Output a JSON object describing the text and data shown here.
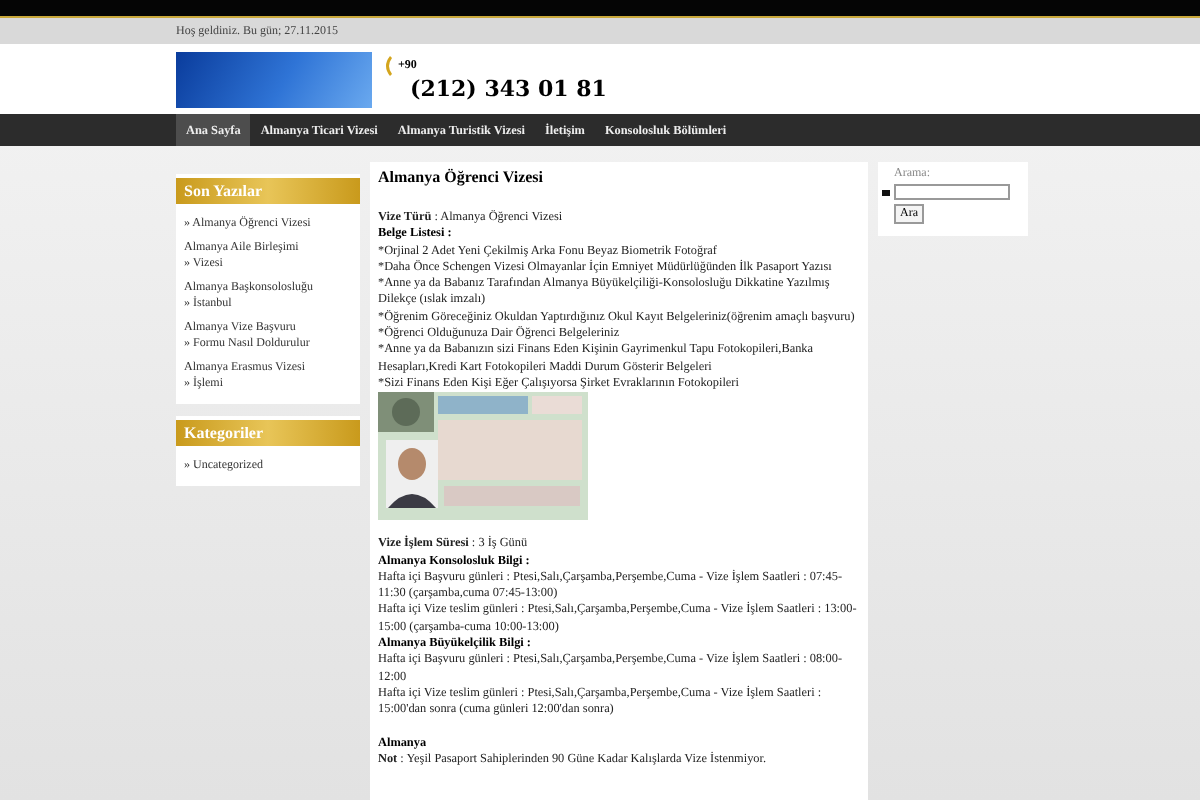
{
  "topbar": {
    "welcome": "Hoş geldiniz. Bu gün; 27.11.2015"
  },
  "header": {
    "phone_prefix": "+90",
    "phone": "(212) 343 01 81"
  },
  "nav": [
    {
      "label": "Ana Sayfa",
      "selected": true
    },
    {
      "label": "Almanya Ticari Vizesi",
      "selected": false
    },
    {
      "label": "Almanya Turistik Vizesi",
      "selected": false
    },
    {
      "label": "İletişim",
      "selected": false
    },
    {
      "label": "Konsolosluk Bölümleri",
      "selected": false
    }
  ],
  "sidebar": [
    {
      "title": "Son Yazılar",
      "items": [
        {
          "lines": [
            "» Almanya Öğrenci Vizesi"
          ]
        },
        {
          "lines": [
            "Almanya Aile Birleşimi",
            "» Vizesi"
          ]
        },
        {
          "lines": [
            "Almanya Başkonsolosluğu",
            "» İstanbul"
          ]
        },
        {
          "lines": [
            "Almanya Vize Başvuru",
            "» Formu Nasıl Doldurulur"
          ]
        },
        {
          "lines": [
            "Almanya Erasmus Vizesi",
            "» İşlemi"
          ]
        }
      ]
    },
    {
      "title": "Kategoriler",
      "items": [
        {
          "lines": [
            "» Uncategorized"
          ]
        }
      ]
    }
  ],
  "article": {
    "title": "Almanya Öğrenci Vizesi",
    "sections": [
      [
        {
          "kind": "text",
          "text": "**Vize Türü** : Almanya Öğrenci Vizesi"
        },
        {
          "kind": "heading",
          "text": "Belge Listesi :"
        },
        {
          "kind": "text",
          "text": "*Orjinal 2 Adet Yeni Çekilmiş Arka Fonu Beyaz Biometrik Fotoğraf"
        },
        {
          "kind": "text",
          "text": "*Daha Önce Schengen Vizesi Olmayanlar İçin Emniyet Müdürlüğünden İlk Pasaport Yazısı"
        },
        {
          "kind": "text",
          "text": "*Anne ya da Babanız Tarafından Almanya Büyükelçiliği-Konsolosluğu Dikkatine Yazılmış Dilekçe (ıslak imzalı)"
        },
        {
          "kind": "text",
          "text": "*Öğrenim Göreceğiniz Okuldan Yaptırdığınız Okul Kayıt Belgeleriniz(öğrenim amaçlı başvuru)"
        },
        {
          "kind": "text",
          "text": "*Öğrenci Olduğunuza Dair Öğrenci Belgeleriniz"
        },
        {
          "kind": "text",
          "text": "*Anne ya da Babanızın sizi Finans Eden Kişinin Gayrimenkul Tapu Fotokopileri,Banka Hesapları,Kredi Kart Fotokopileri Maddi Durum Gösterir Belgeleri"
        },
        {
          "kind": "text",
          "text": "*Sizi Finans Eden Kişi Eğer Çalışıyorsa Şirket Evraklarının Fotokopileri"
        },
        {
          "kind": "picture"
        }
      ],
      [
        {
          "kind": "text",
          "text": "**Vize İşlem Süresi** : 3 İş Günü"
        },
        {
          "kind": "heading",
          "text": "Almanya Konsolosluk Bilgi :"
        },
        {
          "kind": "text",
          "text": "Hafta içi Başvuru günleri : Ptesi,Salı,Çarşamba,Perşembe,Cuma  - Vize İşlem Saatleri : 07:45-11:30 (çarşamba,cuma 07:45-13:00)"
        },
        {
          "kind": "text",
          "text": "Hafta içi Vize teslim günleri : Ptesi,Salı,Çarşamba,Perşembe,Cuma  - Vize İşlem Saatleri : 13:00-15:00 (çarşamba-cuma 10:00-13:00)"
        },
        {
          "kind": "heading",
          "text": "Almanya Büyükelçilik Bilgi :"
        },
        {
          "kind": "text",
          "text": "Hafta içi Başvuru günleri : Ptesi,Salı,Çarşamba,Perşembe,Cuma  - Vize İşlem Saatleri : 08:00-12:00"
        },
        {
          "kind": "text",
          "text": "Hafta içi Vize teslim günleri : Ptesi,Salı,Çarşamba,Perşembe,Cuma  - Vize İşlem Saatleri : 15:00'dan sonra (cuma günleri 12:00'dan sonra)"
        }
      ],
      [
        {
          "kind": "heading",
          "text": "Almanya"
        },
        {
          "kind": "text",
          "text": "**Not** : Yeşil Pasaport Sahiplerinden 90 Güne Kadar Kalışlarda Vize İstenmiyor."
        }
      ]
    ]
  },
  "search": {
    "label": "Arama:",
    "button": "Ara"
  }
}
